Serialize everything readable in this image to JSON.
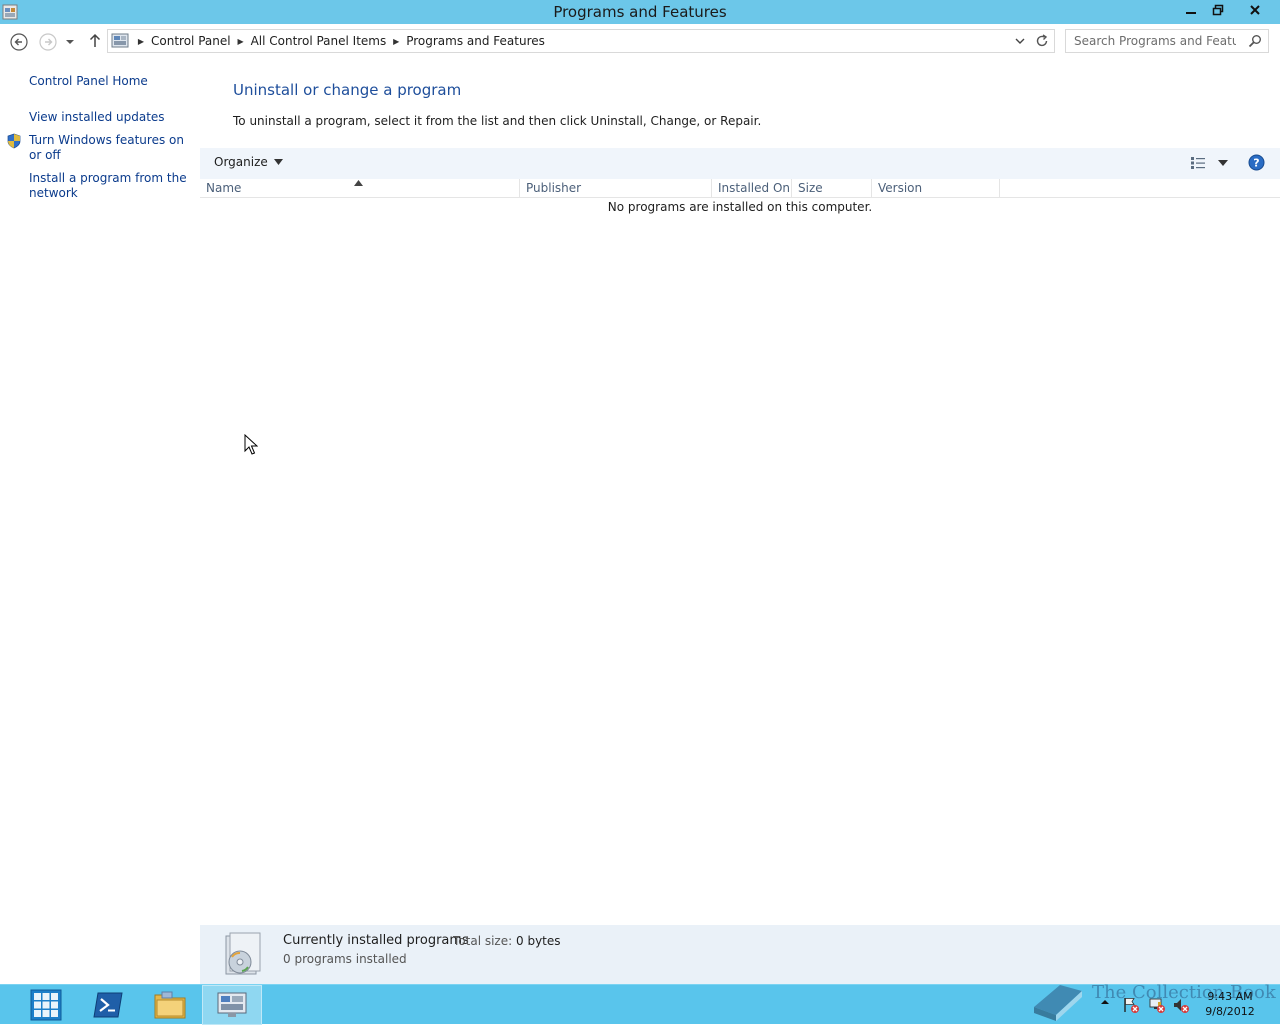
{
  "window": {
    "title": "Programs and Features"
  },
  "address": {
    "crumbs": [
      "Control Panel",
      "All Control Panel Items",
      "Programs and Features"
    ]
  },
  "search": {
    "placeholder": "Search Programs and Features"
  },
  "leftpane": {
    "home": "Control Panel Home",
    "updates": "View installed updates",
    "features": "Turn Windows features on or off",
    "network": "Install a program from the network"
  },
  "main": {
    "title": "Uninstall or change a program",
    "description": "To uninstall a program, select it from the list and then click Uninstall, Change, or Repair.",
    "organize_label": "Organize",
    "columns": {
      "name": "Name",
      "publisher": "Publisher",
      "installed_on": "Installed On",
      "size": "Size",
      "version": "Version"
    },
    "empty_message": "No programs are installed on this computer."
  },
  "details": {
    "title": "Currently installed programs",
    "total_size_label": "Total size:",
    "total_size_value": "0 bytes",
    "count": "0 programs installed"
  },
  "taskbar": {
    "watermark": "The Collection Book",
    "clock_time": "9:43 AM",
    "clock_date": "9/8/2012"
  },
  "colors": {
    "titlebar": "#6cc7e9",
    "taskbar": "#59c5ec",
    "link": "#0b3b8c",
    "heading": "#1e4e9b",
    "toolbar": "#f0f5fb",
    "details": "#eaf1f8"
  },
  "icons": [
    "app-icon",
    "minimize-icon",
    "restore-icon",
    "close-icon",
    "back-icon",
    "forward-icon",
    "up-icon",
    "refresh-icon",
    "search-icon",
    "shield-icon",
    "help-icon",
    "view-icon",
    "package-icon",
    "start-icon",
    "powershell-icon",
    "folder-icon",
    "control-panel-icon",
    "book-icon",
    "flag-icon",
    "network-icon",
    "volume-icon"
  ]
}
